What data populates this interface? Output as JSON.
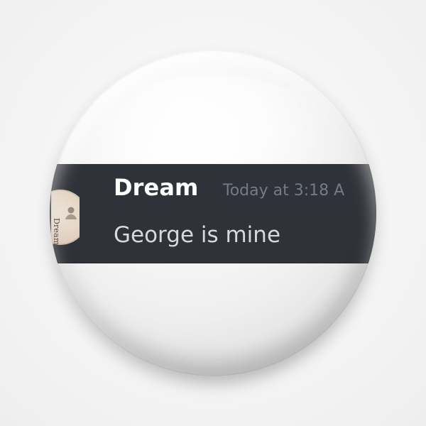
{
  "message": {
    "username": "Dream",
    "timestamp": "Today at 3:18 A",
    "content": "George is mine",
    "avatar_label": "Dream"
  },
  "icons": {
    "avatar": "profile-avatar-icon"
  },
  "colors": {
    "background": "#f7f7f7",
    "pin_face": "#f1f1f1",
    "message_bar": "#2f3238",
    "username": "#ffffff",
    "timestamp": "#747b85",
    "message_text": "#d7d9dd",
    "avatar_bg": "#e6d6c4"
  }
}
